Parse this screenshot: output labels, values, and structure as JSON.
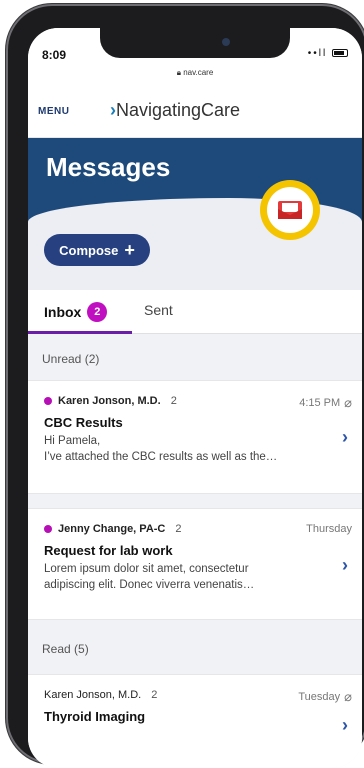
{
  "status": {
    "time": "8:09",
    "signal": "••ll",
    "url": "nav.care"
  },
  "app": {
    "menu_label": "MENU",
    "brand_prefix": "›",
    "brand_name": "NavigatingCare"
  },
  "hero": {
    "title": "Messages"
  },
  "compose": {
    "label": "Compose",
    "icon": "+"
  },
  "tabs": [
    {
      "label": "Inbox",
      "count": "2"
    },
    {
      "label": "Sent"
    }
  ],
  "sections": {
    "unread_label": "Unread (2)",
    "read_label": "Read (5)"
  },
  "messages": [
    {
      "sender": "Karen Jonson, M.D.",
      "count": "2",
      "time": "4:15 PM",
      "subject": "CBC Results",
      "preview_line1": "Hi Pamela,",
      "preview_line2": "I’ve attached the CBC results as well as the…",
      "has_attachment": true
    },
    {
      "sender": "Jenny Change, PA-C",
      "count": "2",
      "time": "Thursday",
      "subject": "Request for lab work",
      "preview_line1": "Lorem ipsum dolor sit amet, consectetur",
      "preview_line2": "adipiscing elit. Donec viverra venenatis…",
      "has_attachment": false
    },
    {
      "sender": "Karen Jonson, M.D.",
      "count": "2",
      "time": "Tuesday",
      "subject": "Thyroid Imaging",
      "has_attachment": true
    }
  ],
  "colors": {
    "brand_blue": "#1d4a7a",
    "compose_blue": "#27407f",
    "badge_magenta": "#c00fc0",
    "accent_yellow": "#f5c400",
    "envelope_red": "#e33b3b"
  }
}
